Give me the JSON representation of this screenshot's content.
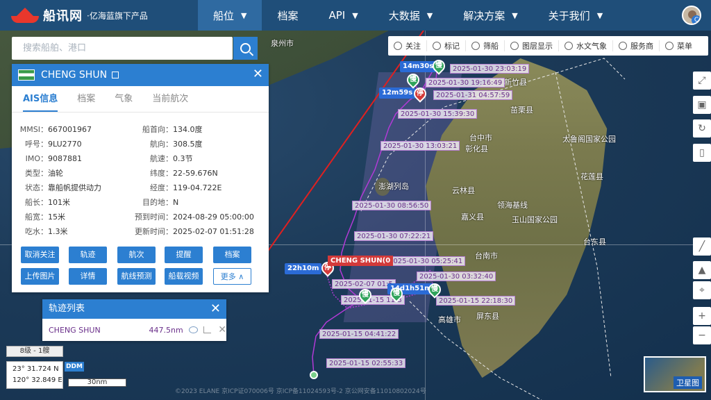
{
  "brand": {
    "name": "船讯网",
    "sub": "·亿海蓝旗下产品"
  },
  "nav": [
    {
      "label": "船位",
      "chevron": true,
      "active": true
    },
    {
      "label": "档案",
      "chevron": false
    },
    {
      "label": "API",
      "chevron": true
    },
    {
      "label": "大数据",
      "chevron": true
    },
    {
      "label": "解决方案",
      "chevron": true
    },
    {
      "label": "关于我们",
      "chevron": true
    }
  ],
  "search": {
    "placeholder": "搜索船舶、港口"
  },
  "map_tools": [
    "关注",
    "标记",
    "筛船",
    "图层显示",
    "水文气象",
    "服务商",
    "菜单"
  ],
  "panel": {
    "ship_name": "CHENG SHUN",
    "tabs": [
      "AIS信息",
      "档案",
      "气象",
      "当前航次"
    ],
    "left": [
      {
        "k": "MMSI：",
        "v": "667001967"
      },
      {
        "k": "呼号：",
        "v": "9LU2770"
      },
      {
        "k": "IMO：",
        "v": "9087881"
      },
      {
        "k": "类型：",
        "v": "油轮"
      },
      {
        "k": "状态：",
        "v": "靠船帆提供动力"
      },
      {
        "k": "船长：",
        "v": "101米"
      },
      {
        "k": "船宽：",
        "v": "15米"
      },
      {
        "k": "吃水：",
        "v": "1.3米"
      }
    ],
    "right": [
      {
        "k": "船首向：",
        "v": "134.0度"
      },
      {
        "k": "航向：",
        "v": "308.5度"
      },
      {
        "k": "航速：",
        "v": "0.3节"
      },
      {
        "k": "纬度：",
        "v": "22-59.676N"
      },
      {
        "k": "经度：",
        "v": "119-04.722E"
      },
      {
        "k": "目的地：",
        "v": "N"
      },
      {
        "k": "预到时间：",
        "v": "2024-08-29 05:00:00"
      },
      {
        "k": "更新时间：",
        "v": "2025-02-07 01:51:28"
      }
    ],
    "buttons_row1": [
      "取消关注",
      "轨迹",
      "航次",
      "提醒",
      "档案"
    ],
    "buttons_row2": [
      "上传图片",
      "详情",
      "航线预测",
      "船载视频",
      "更多 ∧"
    ]
  },
  "tracklist": {
    "title": "轨迹列表",
    "name": "CHENG SHUN",
    "distance": "447.5nm"
  },
  "bottom": {
    "level": "8级 - 1艘",
    "lat": "23° 31.724 N",
    "lon": "120° 32.849 E",
    "ddm": "DDM",
    "scale": "30nm",
    "copyright": "©2023 ELANE  京ICP证070006号  京ICP备11024593号-2  京公网安备11010802024号"
  },
  "minimap_label": "卫星图",
  "places": [
    {
      "t": "泉州市"
    },
    {
      "t": "澎湖列岛"
    },
    {
      "t": "台中市"
    },
    {
      "t": "彰化县"
    },
    {
      "t": "云林县"
    },
    {
      "t": "嘉义县"
    },
    {
      "t": "台南市"
    },
    {
      "t": "高雄市"
    },
    {
      "t": "屏东县"
    },
    {
      "t": "花莲县"
    },
    {
      "t": "太鲁阁国家公园"
    },
    {
      "t": "玉山国家公园"
    },
    {
      "t": "台东县"
    },
    {
      "t": "领海基线"
    },
    {
      "t": "新竹县"
    },
    {
      "t": "苗栗县"
    },
    {
      "t": "台北"
    }
  ],
  "track": {
    "vessel_label": "CHENG SHUN(0",
    "durations": [
      "14m30s",
      "12m59s",
      "22h10m",
      "14d1h51m"
    ],
    "pins": [
      "慢",
      "停",
      "慢",
      "慢",
      "停",
      "慢",
      "停"
    ],
    "timestamps": [
      "2025-01-30 23:03:19",
      "2025-01-30 19:16:49",
      "2025-01-31 04:57:59",
      "2025-01-30 15:39:30",
      "2025-01-30 13:03:21",
      "2025-01-30 08:56:50",
      "2025-01-30 07:22:21",
      "2025-01-30 05:25:41",
      "2025-01-30 03:32:40",
      "2025-02-07 01:5",
      "2025-01-15 11:3",
      "2025-01-15 22:18:30",
      "2025-01-15 04:41:22",
      "2025-01-15 02:55:33"
    ]
  }
}
